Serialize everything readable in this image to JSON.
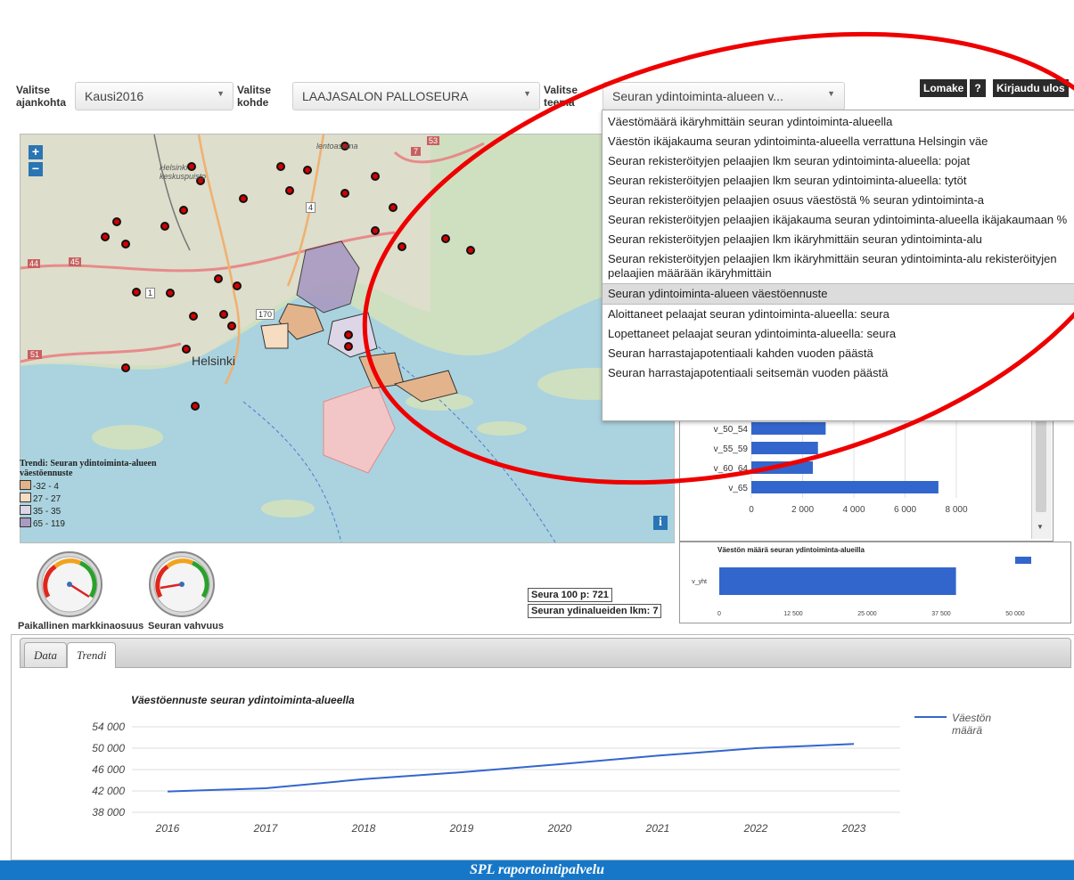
{
  "controls": {
    "time_label_1": "Valitse",
    "time_label_2": "ajankohta",
    "time_value": "Kausi2016",
    "target_label_1": "Valitse",
    "target_label_2": "kohde",
    "target_value": "LAAJASALON PALLOSEURA",
    "theme_label_1": "Valitse",
    "theme_label_2": "teema",
    "theme_value": "Seuran ydintoiminta-alueen v..."
  },
  "top_buttons": {
    "form": "Lomake",
    "help": "?",
    "logout": "Kirjaudu ulos"
  },
  "theme_dropdown": {
    "items": [
      "Väestömäärä ikäryhmittäin seuran ydintoiminta-alueella",
      "Väestön ikäjakauma seuran ydintoiminta-alueella verrattuna Helsingin väe",
      "Seuran rekisteröityjen pelaajien lkm seuran ydintoiminta-alueella: pojat",
      "Seuran rekisteröityjen pelaajien lkm seuran ydintoiminta-alueella: tytöt",
      "Seuran rekisteröityjen pelaajien osuus väestöstä % seuran ydintoiminta-a",
      "Seuran rekisteröityjen pelaajien ikäjakauma seuran ydintoiminta-alueella ikäjakaumaan %",
      "Seuran rekisteröityjen pelaajien lkm ikäryhmittäin seuran ydintoiminta-alu",
      "Seuran rekisteröityjen pelaajien lkm ikäryhmittäin seuran ydintoiminta-alu rekisteröityjen pelaajien määrään ikäryhmittäin",
      "Seuran ydintoiminta-alueen väestöennuste",
      "Aloittaneet pelaajat seuran ydintoiminta-alueella: seura",
      "Lopettaneet pelaajat seuran ydintoiminta-alueella: seura",
      "Seuran harrastajapotentiaali kahden vuoden päästä",
      "Seuran harrastajapotentiaali seitsemän vuoden päästä"
    ],
    "active_index": 8
  },
  "map": {
    "zoom_in": "+",
    "zoom_out": "−",
    "info": "i",
    "place_labels": [
      "Helsinki",
      "Helsinki keskuspuisto",
      "lentoasema"
    ],
    "road_numbers": [
      "51",
      "170",
      "1",
      "45",
      "44",
      "4",
      "7",
      "53"
    ],
    "legend": {
      "title": "Trendi: Seuran ydintoiminta-alueen väestöennuste",
      "classes": [
        {
          "label": "-32 - 4",
          "color": "#e3b48c"
        },
        {
          "label": "27 - 27",
          "color": "#f6dcc0"
        },
        {
          "label": "35 - 35",
          "color": "#dcd6e6"
        },
        {
          "label": "65 - 119",
          "color": "#a99ac2"
        }
      ]
    }
  },
  "gauges": {
    "market_share_label": "Paikallinen markkinaosuus",
    "strength_label": "Seuran vahvuus"
  },
  "info_boxes": {
    "club_points": "Seura 100 p: 721",
    "core_areas": "Seuran ydinalueiden lkm: 7"
  },
  "age_chart": {
    "categories": [
      "v_50_54",
      "v_55_59",
      "v_60_64",
      "v_65"
    ],
    "ticks": [
      "0",
      "2 000",
      "4 000",
      "6 000",
      "8 000"
    ]
  },
  "pop_chart": {
    "title": "Väestön määrä seuran ydintoiminta-alueilla",
    "category": "v_yht",
    "ticks": [
      "0",
      "12 500",
      "25 000",
      "37 500",
      "50 000"
    ]
  },
  "tabs": {
    "data": "Data",
    "trend": "Trendi"
  },
  "trend_chart": {
    "title": "Väestöennuste seuran ydintoiminta-alueella",
    "legend_1": "Väestön",
    "legend_2": "määrä",
    "y_ticks": [
      "54 000",
      "50 000",
      "46 000",
      "42 000",
      "38 000"
    ]
  },
  "footer": {
    "title": "SPL raportointipalvelu"
  },
  "chart_data": [
    {
      "type": "bar",
      "orientation": "horizontal",
      "categories": [
        "v_50_54",
        "v_55_59",
        "v_60_64",
        "v_65"
      ],
      "values": [
        2900,
        2600,
        2400,
        7300
      ],
      "xlim": [
        0,
        9000
      ],
      "color": "#3366cc"
    },
    {
      "type": "bar",
      "orientation": "horizontal",
      "title": "Väestön määrä seuran ydintoiminta-alueilla",
      "categories": [
        "v_yht"
      ],
      "values": [
        40000
      ],
      "xlim": [
        0,
        55000
      ],
      "color": "#3366cc"
    },
    {
      "type": "line",
      "title": "Väestöennuste seuran ydintoiminta-alueella",
      "x": [
        2016,
        2017,
        2018,
        2019,
        2020,
        2021,
        2022,
        2023
      ],
      "series": [
        {
          "name": "Väestön määrä",
          "values": [
            41900,
            42500,
            44200,
            45500,
            47000,
            48600,
            50000,
            50800
          ]
        }
      ],
      "ylim": [
        38000,
        54000
      ],
      "color": "#3366cc"
    }
  ]
}
